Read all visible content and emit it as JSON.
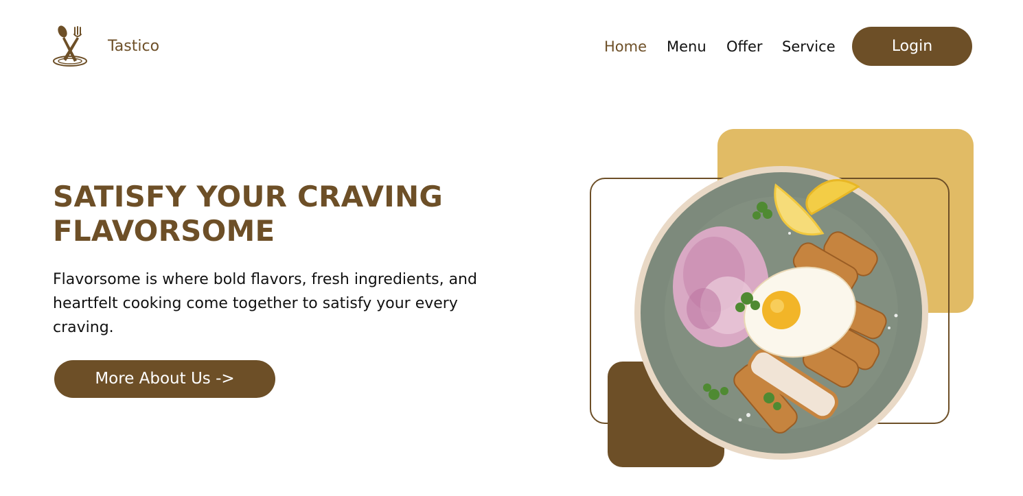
{
  "header": {
    "brand": "Tastico",
    "nav": [
      "Home",
      "Menu",
      "Offer",
      "Service"
    ],
    "active_nav": "Home",
    "login_label": "Login"
  },
  "hero": {
    "title_lines": [
      "SATISFY YOUR CRAVING",
      "FLAVORSOME"
    ],
    "description_lines": [
      "Flavorsome is where bold flavors, fresh ingredients, and",
      "heartfelt cooking come together to satisfy your every",
      "craving."
    ],
    "cta_label": "More About Us ->"
  },
  "icons": {
    "logo": "spoon-fork-plate-icon"
  },
  "colors": {
    "brand": "#6d4f27",
    "accent_yellow": "#e1bb65",
    "text": "#111111",
    "background": "#ffffff"
  }
}
